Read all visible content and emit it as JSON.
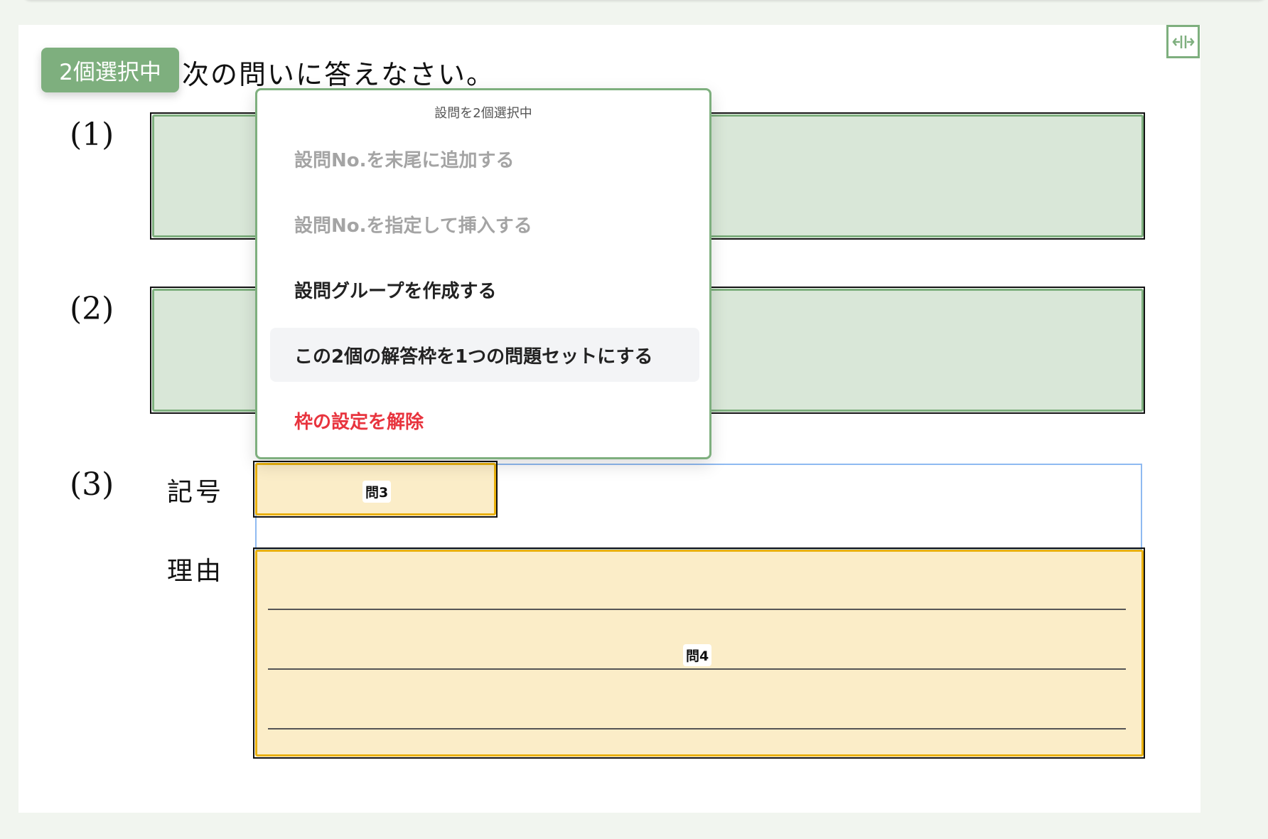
{
  "selection_badge": "2個選択中",
  "sheet": {
    "title": "次の問いに答えなさい。",
    "questions": [
      {
        "number": "(1)"
      },
      {
        "number": "(2)"
      },
      {
        "number": "(3)",
        "rows": [
          {
            "label": "記号",
            "frame_tag": "問3"
          },
          {
            "label": "理由",
            "frame_tag": "問4"
          }
        ]
      }
    ]
  },
  "context_menu": {
    "header": "設問を2個選択中",
    "items": [
      {
        "label": "設問No.を末尾に追加する",
        "state": "disabled"
      },
      {
        "label": "設問No.を指定して挿入する",
        "state": "disabled"
      },
      {
        "label": "設問グループを作成する",
        "state": "enabled"
      },
      {
        "label": "この2個の解答枠を1つの問題セットにする",
        "state": "hover"
      },
      {
        "label": "枠の設定を解除",
        "state": "danger"
      }
    ]
  },
  "colors": {
    "accent_green": "#7eaf7e",
    "selected_fill": "#d9e7d8",
    "frame_yellow": "#e9b00c",
    "frame_yellow_fill": "#fbedc8",
    "danger": "#e8343e",
    "selection_outline": "#8fbaf1"
  },
  "icons": {
    "resize_toggle": "horizontal-resize-icon"
  }
}
